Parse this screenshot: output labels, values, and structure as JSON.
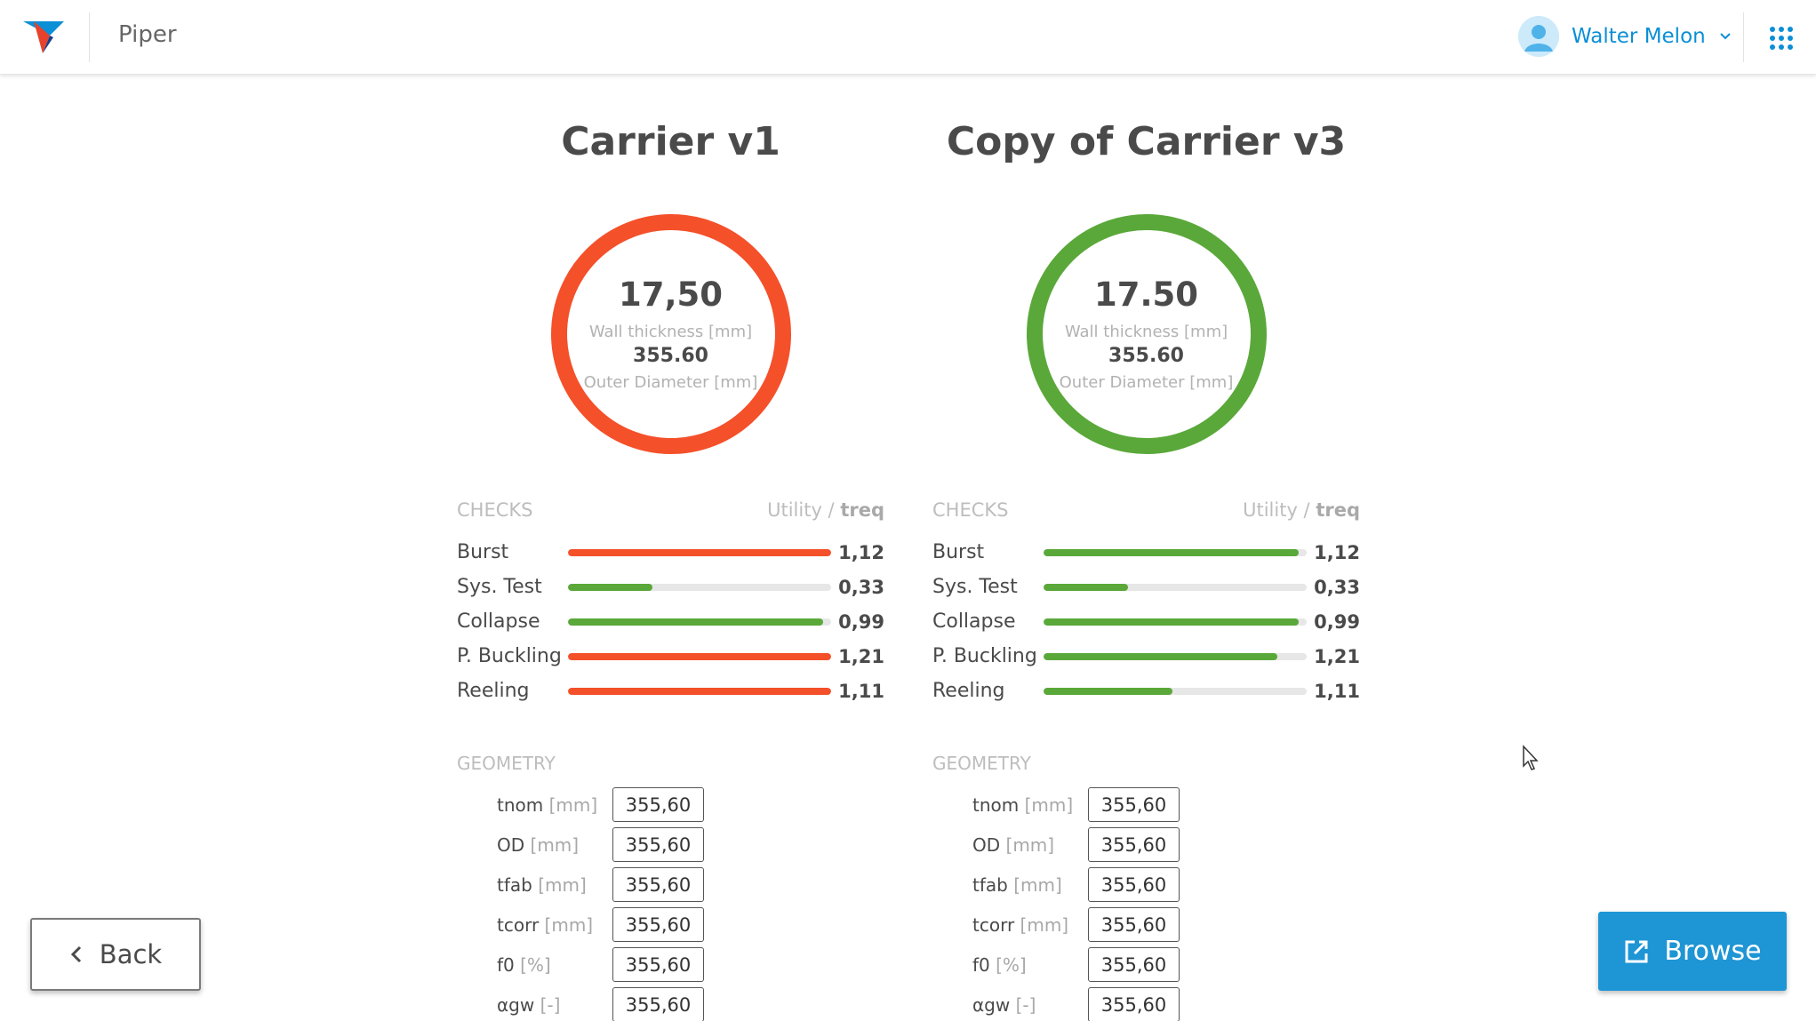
{
  "header": {
    "app_name": "Piper",
    "user_name": "Walter Melon",
    "icons": [
      "logo-icon",
      "user-avatar-icon",
      "chevron-down-icon",
      "apps-grid-icon"
    ],
    "accent_color": "#0b8fd6"
  },
  "designs": [
    {
      "title": "Carrier v1",
      "status_color": "#f4502a",
      "wall_thickness": "17,50",
      "wall_thickness_label": "Wall thickness [mm]",
      "outer_diameter": "355.60",
      "outer_diameter_label": "Outer Diameter [mm]",
      "checks_label": "CHECKS",
      "utility_label": "Utility /",
      "treq_label": "treq",
      "checks": [
        {
          "name": "Burst",
          "value": "1,12",
          "fill": 1.0,
          "color": "#f4502a"
        },
        {
          "name": "Sys. Test",
          "value": "0,33",
          "fill": 0.32,
          "color": "#5aa83a"
        },
        {
          "name": "Collapse",
          "value": "0,99",
          "fill": 0.97,
          "color": "#5aa83a"
        },
        {
          "name": "P. Buckling",
          "value": "1,21",
          "fill": 1.0,
          "color": "#f4502a"
        },
        {
          "name": "Reeling",
          "value": "1,11",
          "fill": 1.0,
          "color": "#f4502a"
        }
      ],
      "geometry_label": "GEOMETRY",
      "geometry": [
        {
          "name": "tnom",
          "unit": "[mm]",
          "value": "355,60"
        },
        {
          "name": "OD",
          "unit": "[mm]",
          "value": "355,60"
        },
        {
          "name": "tfab",
          "unit": "[mm]",
          "value": "355,60"
        },
        {
          "name": "tcorr",
          "unit": "[mm]",
          "value": "355,60"
        },
        {
          "name": "f0",
          "unit": "[%]",
          "value": "355,60"
        },
        {
          "name": "αgw",
          "unit": "[-]",
          "value": "355,60"
        }
      ]
    },
    {
      "title": "Copy of Carrier v3",
      "status_color": "#5aa83a",
      "wall_thickness": "17.50",
      "wall_thickness_label": "Wall thickness [mm]",
      "outer_diameter": "355.60",
      "outer_diameter_label": "Outer Diameter [mm]",
      "checks_label": "CHECKS",
      "utility_label": "Utility /",
      "treq_label": "treq",
      "checks": [
        {
          "name": "Burst",
          "value": "1,12",
          "fill": 0.97,
          "color": "#5aa83a"
        },
        {
          "name": "Sys. Test",
          "value": "0,33",
          "fill": 0.32,
          "color": "#5aa83a"
        },
        {
          "name": "Collapse",
          "value": "0,99",
          "fill": 0.97,
          "color": "#5aa83a"
        },
        {
          "name": "P. Buckling",
          "value": "1,21",
          "fill": 0.89,
          "color": "#5aa83a"
        },
        {
          "name": "Reeling",
          "value": "1,11",
          "fill": 0.49,
          "color": "#5aa83a"
        }
      ],
      "geometry_label": "GEOMETRY",
      "geometry": [
        {
          "name": "tnom",
          "unit": "[mm]",
          "value": "355,60"
        },
        {
          "name": "OD",
          "unit": "[mm]",
          "value": "355,60"
        },
        {
          "name": "tfab",
          "unit": "[mm]",
          "value": "355,60"
        },
        {
          "name": "tcorr",
          "unit": "[mm]",
          "value": "355,60"
        },
        {
          "name": "f0",
          "unit": "[%]",
          "value": "355,60"
        },
        {
          "name": "αgw",
          "unit": "[-]",
          "value": "355,60"
        }
      ]
    }
  ],
  "footer": {
    "back_label": "Back",
    "browse_label": "Browse",
    "browse_color": "#1e95d4"
  }
}
